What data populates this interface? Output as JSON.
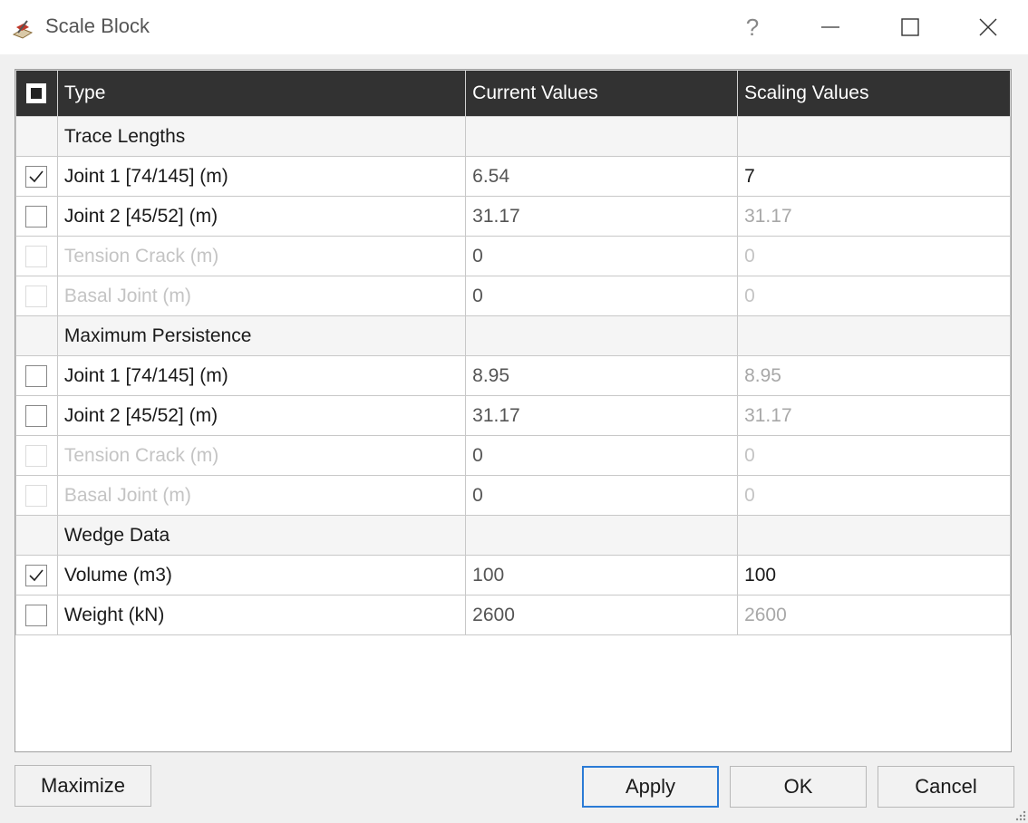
{
  "window": {
    "title": "Scale Block",
    "help_glyph": "?"
  },
  "table": {
    "columns": [
      "Type",
      "Current Values",
      "Scaling Values"
    ],
    "rows": [
      {
        "kind": "group",
        "label": "Trace Lengths"
      },
      {
        "kind": "item",
        "checked": true,
        "enabled": true,
        "label": "Joint 1 [74/145] (m)",
        "current": "6.54",
        "scaling": "7"
      },
      {
        "kind": "item",
        "checked": false,
        "enabled": true,
        "label": "Joint 2 [45/52] (m)",
        "current": "31.17",
        "scaling": "31.17"
      },
      {
        "kind": "item",
        "checked": false,
        "enabled": false,
        "label": "Tension Crack (m)",
        "current": "0",
        "scaling": "0"
      },
      {
        "kind": "item",
        "checked": false,
        "enabled": false,
        "label": "Basal Joint (m)",
        "current": "0",
        "scaling": "0"
      },
      {
        "kind": "group",
        "label": "Maximum Persistence"
      },
      {
        "kind": "item",
        "checked": false,
        "enabled": true,
        "label": "Joint 1 [74/145] (m)",
        "current": "8.95",
        "scaling": "8.95"
      },
      {
        "kind": "item",
        "checked": false,
        "enabled": true,
        "label": "Joint 2 [45/52] (m)",
        "current": "31.17",
        "scaling": "31.17"
      },
      {
        "kind": "item",
        "checked": false,
        "enabled": false,
        "label": "Tension Crack (m)",
        "current": "0",
        "scaling": "0"
      },
      {
        "kind": "item",
        "checked": false,
        "enabled": false,
        "label": "Basal Joint (m)",
        "current": "0",
        "scaling": "0"
      },
      {
        "kind": "group",
        "label": "Wedge Data"
      },
      {
        "kind": "item",
        "checked": true,
        "enabled": true,
        "label": "Volume (m3)",
        "current": "100",
        "scaling": "100"
      },
      {
        "kind": "item",
        "checked": false,
        "enabled": true,
        "label": "Weight (kN)",
        "current": "2600",
        "scaling": "2600"
      }
    ]
  },
  "buttons": {
    "maximize": "Maximize",
    "apply": "Apply",
    "ok": "OK",
    "cancel": "Cancel"
  }
}
